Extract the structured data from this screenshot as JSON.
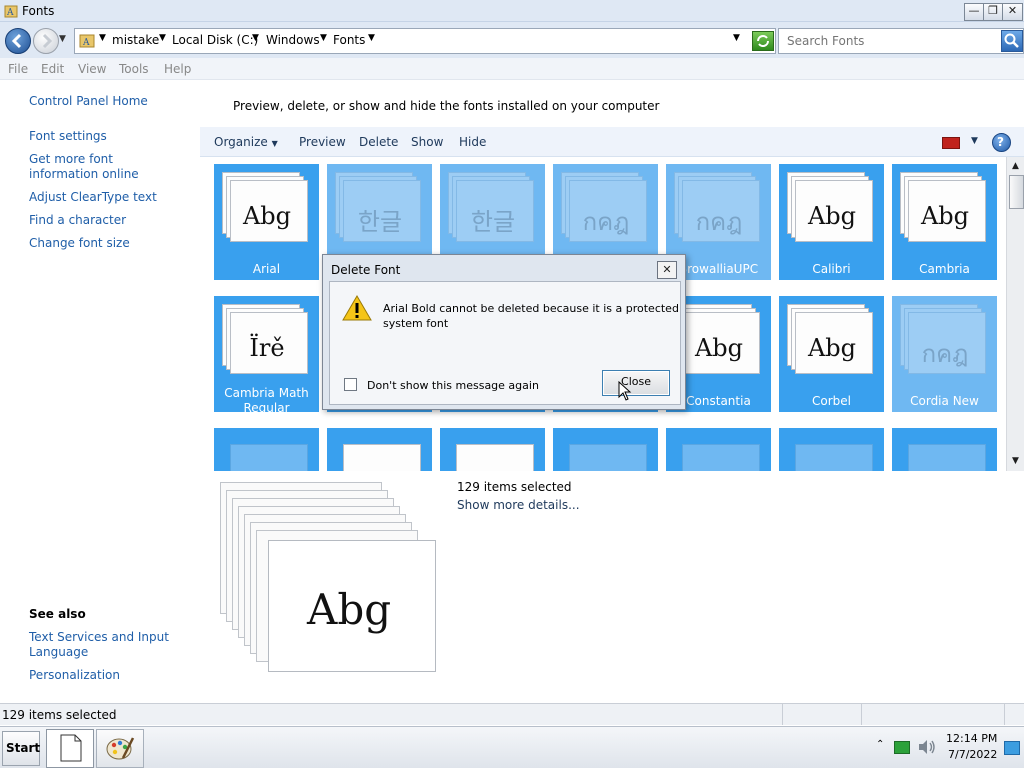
{
  "window": {
    "title": "Fonts"
  },
  "address": {
    "crumbs": [
      "mistake",
      "Local Disk (C:)",
      "Windows",
      "Fonts"
    ],
    "search_placeholder": "Search Fonts"
  },
  "menu": [
    "File",
    "Edit",
    "View",
    "Tools",
    "Help"
  ],
  "left_pane": {
    "home": "Control Panel Home",
    "links": [
      "Font settings",
      "Get more font information online",
      "Adjust ClearType text",
      "Find a character",
      "Change font size"
    ],
    "see_also_title": "See also",
    "see_also": [
      "Text Services and Input Language",
      "Personalization"
    ]
  },
  "header_text": "Preview, delete, or show and hide the fonts installed on your computer",
  "toolbar": {
    "organize": "Organize",
    "preview": "Preview",
    "delete": "Delete",
    "show": "Show",
    "hide": "Hide"
  },
  "fonts_row1": [
    {
      "name": "Arial",
      "sample": "Abg",
      "faded": false
    },
    {
      "name": "",
      "sample": "한글",
      "faded": true
    },
    {
      "name": "",
      "sample": "한글",
      "faded": true
    },
    {
      "name": "",
      "sample": "กคฎ",
      "faded": true
    },
    {
      "name": "BrowalliaUPC",
      "sample": "กคฎ",
      "faded": true
    },
    {
      "name": "Calibri",
      "sample": "Abg",
      "faded": false
    },
    {
      "name": "Cambria",
      "sample": "Abg",
      "faded": false
    }
  ],
  "fonts_row2": [
    {
      "name": "Cambria Math Regular",
      "sample": "Ïrě",
      "faded": false
    },
    {
      "name": "",
      "sample": "",
      "faded": false
    },
    {
      "name": "",
      "sample": "",
      "faded": false
    },
    {
      "name": "",
      "sample": "",
      "faded": false
    },
    {
      "name": "Constantia",
      "sample": "Abg",
      "faded": false
    },
    {
      "name": "Corbel",
      "sample": "Abg",
      "faded": false
    },
    {
      "name": "Cordia New",
      "sample": "กคฎ",
      "faded": true
    }
  ],
  "details": {
    "count": "129 items selected",
    "more": "Show more details...",
    "preview_sample": "Abg"
  },
  "dialog": {
    "title": "Delete Font",
    "message_line1": "Arial Bold cannot be deleted because it is a protected",
    "message_line2": "system font",
    "checkbox_label": "Don't show this message again",
    "close_label": "Close"
  },
  "status": {
    "text": "129 items selected"
  },
  "taskbar": {
    "start": "Start",
    "time": "12:14 PM",
    "date": "7/7/2022"
  },
  "colors": {
    "tile_selected": "#39a0ee",
    "tile_faded": "#6fb8f2",
    "link": "#1f5ea8"
  },
  "icons": [
    "back-icon",
    "forward-icon",
    "folder-icon",
    "refresh-icon",
    "search-icon",
    "warning-icon",
    "help-icon",
    "close-icon",
    "network-icon",
    "volume-icon"
  ]
}
